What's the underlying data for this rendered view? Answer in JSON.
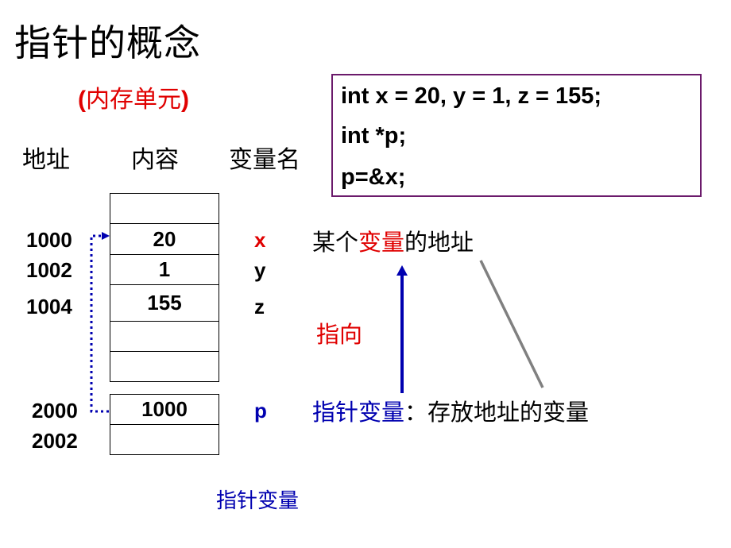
{
  "title": "指针的概念",
  "subtitle": {
    "open": "(",
    "text": "内存单元",
    "close": ")"
  },
  "column_headers": {
    "address": "地址",
    "content": "内容",
    "variable_name": "变量名"
  },
  "code": [
    "int  x = 20, y = 1, z = 155;",
    "int *p;",
    "p=&x;"
  ],
  "memory_cells": [
    {
      "address": "",
      "content": "",
      "variable": ""
    },
    {
      "address": "1000",
      "content": "20",
      "variable": "x",
      "variable_color": "#e00000"
    },
    {
      "address": "1002",
      "content": "1",
      "variable": "y",
      "variable_color": "#000000"
    },
    {
      "address": "1004",
      "content": "155",
      "variable": "z",
      "variable_color": "#000000"
    },
    {
      "address": "",
      "content": "",
      "variable": ""
    },
    {
      "address": "",
      "content": "",
      "variable": ""
    }
  ],
  "pointer_cells": [
    {
      "address": "2000",
      "content": "1000",
      "variable": "p",
      "variable_color": "#0000b0"
    },
    {
      "address": "2002",
      "content": "",
      "variable": ""
    }
  ],
  "notes": {
    "address_of_var": {
      "part1": "某个",
      "part2": "变量",
      "part3": "的地址"
    },
    "points_to": "指向",
    "pointer_def": {
      "term": "指针变量",
      "definition": "：存放地址的变量"
    },
    "bottom_label": "指针变量"
  },
  "colors": {
    "red": "#e00000",
    "blue": "#0000b0",
    "black": "#000000",
    "gray": "#808080",
    "code_border": "#6b1a6b"
  }
}
